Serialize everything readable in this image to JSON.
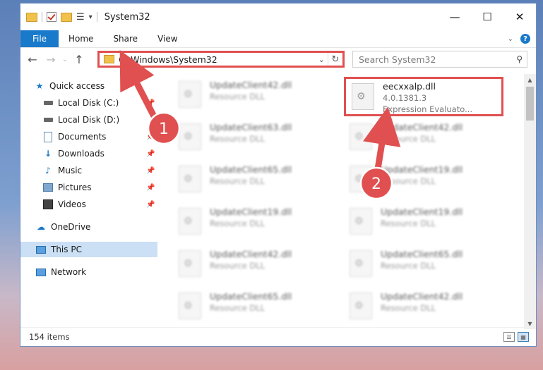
{
  "window": {
    "title": "System32",
    "controls": {
      "minimize": "—",
      "maximize": "☐",
      "close": "✕"
    }
  },
  "ribbon": {
    "file_label": "File",
    "tabs": [
      "Home",
      "Share",
      "View"
    ]
  },
  "address_bar": {
    "path": "C:\\Windows\\System32"
  },
  "search": {
    "placeholder": "Search System32"
  },
  "sidebar": {
    "items": [
      {
        "label": "Quick access",
        "icon": "star-icon",
        "color": "#1979ca"
      },
      {
        "label": "Local Disk (C:)",
        "icon": "drive-icon",
        "pinned": true
      },
      {
        "label": "Local Disk (D:)",
        "icon": "drive-icon"
      },
      {
        "label": "Documents",
        "icon": "documents-icon",
        "pinned": true
      },
      {
        "label": "Downloads",
        "icon": "download-icon",
        "pinned": true
      },
      {
        "label": "Music",
        "icon": "music-icon",
        "pinned": true
      },
      {
        "label": "Pictures",
        "icon": "pictures-icon",
        "pinned": true
      },
      {
        "label": "Videos",
        "icon": "videos-icon",
        "pinned": true
      },
      {
        "label": "OneDrive",
        "icon": "cloud-icon"
      },
      {
        "label": "This PC",
        "icon": "computer-icon",
        "selected": true
      },
      {
        "label": "Network",
        "icon": "network-icon"
      }
    ]
  },
  "files": {
    "left": [
      {
        "name": "UpdateClient42.dll",
        "type": "Resource DLL"
      },
      {
        "name": "UpdateClient63.dll",
        "type": "Resource DLL"
      },
      {
        "name": "UpdateClient65.dll",
        "type": "Resource DLL"
      },
      {
        "name": "UpdateClient19.dll",
        "type": "Resource DLL"
      },
      {
        "name": "UpdateClient42.dll",
        "type": "Resource DLL"
      },
      {
        "name": "UpdateClient65.dll",
        "type": "Resource DLL"
      }
    ],
    "right": [
      {
        "name": "eecxxalp.dll",
        "version": "4.0.1381.3",
        "type": "Expression Evaluato...",
        "highlighted": true
      },
      {
        "name": "UpdateClient42.dll",
        "type": "Resource DLL"
      },
      {
        "name": "UpdateClient19.dll",
        "type": "Resource DLL"
      },
      {
        "name": "UpdateClient19.dll",
        "type": "Resource DLL"
      },
      {
        "name": "UpdateClient65.dll",
        "type": "Resource DLL"
      },
      {
        "name": "UpdateClient42.dll",
        "type": "Resource DLL"
      }
    ]
  },
  "status": {
    "item_count": "154 items"
  },
  "annotations": {
    "marker1": "1",
    "marker2": "2",
    "color": "#e05050"
  }
}
